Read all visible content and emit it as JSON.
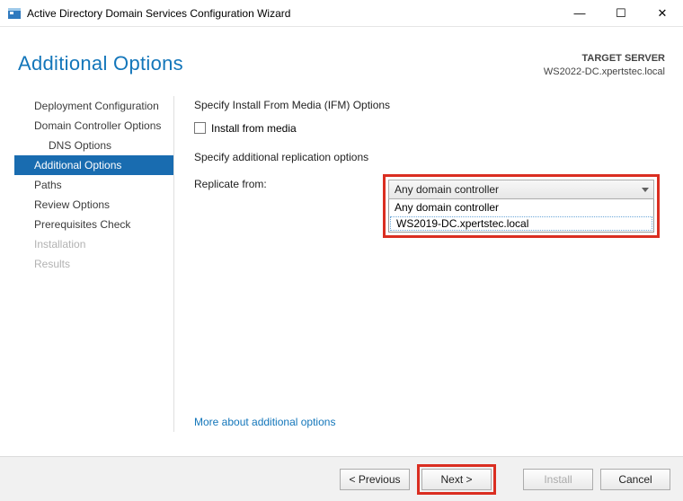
{
  "window": {
    "title": "Active Directory Domain Services Configuration Wizard"
  },
  "header": {
    "page_title": "Additional Options",
    "target_label": "TARGET SERVER",
    "target_value": "WS2022-DC.xpertstec.local"
  },
  "sidebar": {
    "items": [
      {
        "label": "Deployment Configuration"
      },
      {
        "label": "Domain Controller Options"
      },
      {
        "label": "DNS Options"
      },
      {
        "label": "Additional Options"
      },
      {
        "label": "Paths"
      },
      {
        "label": "Review Options"
      },
      {
        "label": "Prerequisites Check"
      },
      {
        "label": "Installation"
      },
      {
        "label": "Results"
      }
    ]
  },
  "content": {
    "ifm_heading": "Specify Install From Media (IFM) Options",
    "ifm_checkbox": "Install from media",
    "repl_heading": "Specify additional replication options",
    "repl_label": "Replicate from:",
    "combo_selected": "Any domain controller",
    "options": [
      "Any domain controller",
      "WS2019-DC.xpertstec.local"
    ],
    "more_link": "More about additional options"
  },
  "footer": {
    "previous": "< Previous",
    "next": "Next >",
    "install": "Install",
    "cancel": "Cancel"
  }
}
